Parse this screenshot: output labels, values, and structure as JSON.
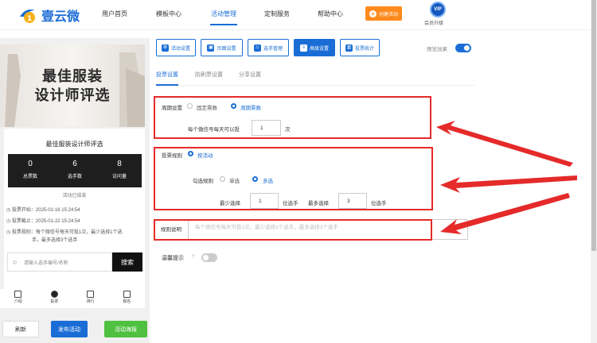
{
  "header": {
    "logo_text": "壹云微",
    "nav": [
      "用户首页",
      "模板中心",
      "活动管理",
      "定制服务",
      "帮助中心"
    ],
    "active_nav": "活动管理",
    "create_label": "创建活动",
    "vip_badge": "VIP",
    "vip_label": "会员升级",
    "colors": {
      "brand": "#1b6dd6",
      "create": "#ff8a1c"
    }
  },
  "preview": {
    "banner_line1": "最佳服装",
    "banner_line2": "设计师评选",
    "title": "最佳服装设计师评选",
    "stats": [
      {
        "num": "0",
        "label": "总票数"
      },
      {
        "num": "6",
        "label": "选手数"
      },
      {
        "num": "8",
        "label": "访问量"
      }
    ],
    "status": "活动已结束",
    "start": "投票开始：2025-01-16 15:24:54",
    "end": "投票截止：2025-01-22 15:24:54",
    "rule_line1": "投票规则：每个微信号每天可投1次，最少选择1个选",
    "rule_line2": "手，最多选择3个选手",
    "search_placeholder": "请输入选手编号/名称",
    "search_btn": "搜索",
    "tabbar": [
      "介绍",
      "投票",
      "排行",
      "报名"
    ],
    "btn_refresh": "刷新",
    "btn_publish": "发布活动",
    "btn_poster": "活动海报"
  },
  "settings": {
    "tabs": [
      "活动设置",
      "页面设置",
      "选手管理",
      "高级设置",
      "投票统计"
    ],
    "tab_icons": [
      "gear-icon",
      "page-icon",
      "users-icon",
      "sliders-icon",
      "chart-icon"
    ],
    "active_tab": "高级设置",
    "preview_label": "预览效果",
    "preview_on": true,
    "subtabs": [
      "投票设置",
      "防刷票设置",
      "分享设置"
    ],
    "active_subtab": "投票设置",
    "cycle_label": "周期设置",
    "cycle_options": [
      "固定票数",
      "周期票数"
    ],
    "cycle_selected": "周期票数",
    "per_day_label": "每个微信号每天可以投",
    "per_day_value": "1",
    "per_day_unit": "次",
    "rule_label": "投票规则",
    "rule_option": "按活动",
    "check_label": "勾选规则",
    "check_options": [
      "单选",
      "多选"
    ],
    "check_selected": "多选",
    "min_label": "最少选择",
    "min_value": "1",
    "min_unit": "位选手",
    "max_label": "最多选择",
    "max_value": "3",
    "max_unit": "位选手",
    "desc_label": "规则说明",
    "desc_placeholder": "每个微信号每天可投1次，最少选择1个选手，最多选择3个选手",
    "warm_label": "温馨提示",
    "warm_on": false
  }
}
